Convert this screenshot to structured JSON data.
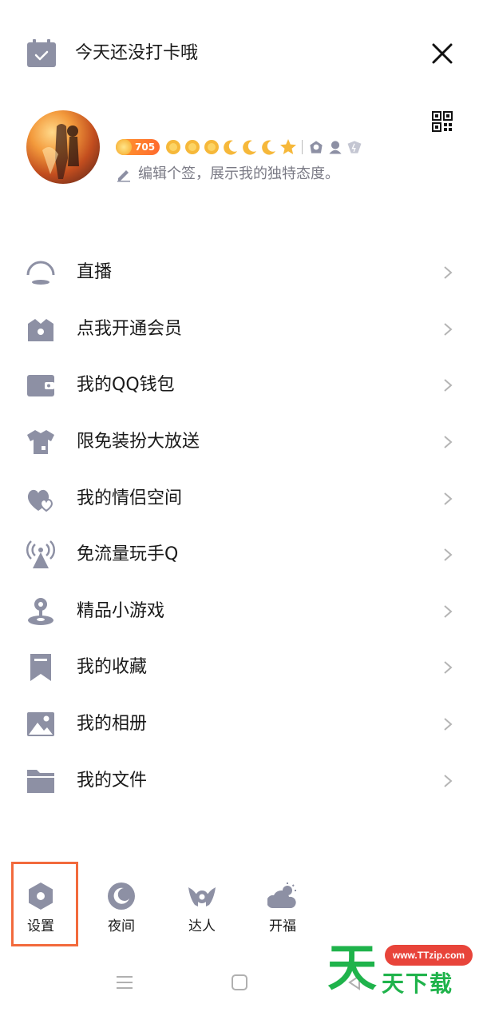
{
  "header": {
    "checkin_label": "今天还没打卡哦",
    "icons": {
      "checkin": "calendar-check-icon",
      "close": "close-icon",
      "qr": "qr-code-icon"
    }
  },
  "profile": {
    "coin_level": "705",
    "signature_placeholder": "编辑个签，展示我的独特态度。",
    "level_icons": [
      "sun-icon",
      "sun-icon",
      "sun-icon",
      "moon-icon",
      "moon-icon",
      "moon-icon",
      "star-icon"
    ],
    "badge_icons": [
      "badge-icon-1",
      "badge-icon-2",
      "badge-icon-3"
    ]
  },
  "menu": {
    "items": [
      {
        "label": "直播",
        "icon": "live-icon"
      },
      {
        "label": "点我开通会员",
        "icon": "crown-icon"
      },
      {
        "label": "我的QQ钱包",
        "icon": "wallet-icon"
      },
      {
        "label": "限免装扮大放送",
        "icon": "tshirt-icon"
      },
      {
        "label": "我的情侣空间",
        "icon": "hearts-icon"
      },
      {
        "label": "免流量玩手Q",
        "icon": "signal-tower-icon"
      },
      {
        "label": "精品小游戏",
        "icon": "joystick-icon"
      },
      {
        "label": "我的收藏",
        "icon": "bookmark-icon"
      },
      {
        "label": "我的相册",
        "icon": "photo-icon"
      },
      {
        "label": "我的文件",
        "icon": "folder-icon"
      }
    ]
  },
  "bottom": {
    "items": [
      {
        "label": "设置",
        "icon": "settings-icon"
      },
      {
        "label": "夜间",
        "icon": "night-mode-icon"
      },
      {
        "label": "达人",
        "icon": "talent-icon"
      },
      {
        "label": "开福",
        "icon": "weather-icon"
      }
    ]
  },
  "watermark": {
    "url": "www.TTzip.com",
    "big_char": "天",
    "small_text": "天下载"
  },
  "colors": {
    "icon_gray": "#8d90a4",
    "highlight": "#f26a3c",
    "watermark_green": "#1fb34b",
    "watermark_red": "#e8443a"
  }
}
